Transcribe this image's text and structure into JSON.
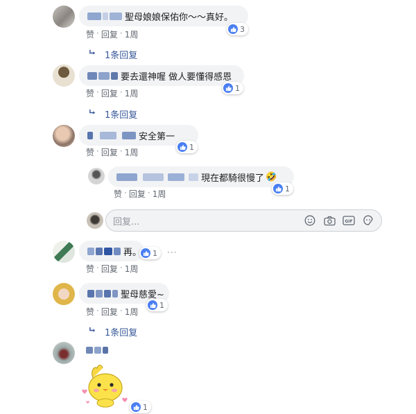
{
  "actions": {
    "like": "赞",
    "reply": "回复",
    "sep": "·",
    "time": "1周"
  },
  "comments": [
    {
      "text": "聖母娘娘保佑你～～真好。",
      "reactions": "3",
      "replies": "1条回复"
    },
    {
      "text": "要去還神喔 做人要懂得感恩",
      "reactions": "1",
      "replies": "1条回复"
    },
    {
      "text": "安全第一",
      "reactions": "1"
    },
    {
      "text": "再。",
      "reactions": "1"
    },
    {
      "text": "聖母慈愛~",
      "reactions": "1",
      "replies": "1条回复"
    },
    {
      "reactions": "1"
    }
  ],
  "nested_reply": {
    "text": "現在都騎很慢了",
    "emoji": "🤣",
    "reactions": "1",
    "time": "1周"
  },
  "reply_box": {
    "placeholder": "回复..."
  },
  "icons": [
    "emoji-icon",
    "camera-icon",
    "gif-icon",
    "sticker-icon",
    "like-icon",
    "reply-arrow-icon",
    "more-icon"
  ],
  "colors": {
    "link": "#385898",
    "bubble": "#f2f3f5",
    "like": "#4a7ff2",
    "meta": "#606770"
  }
}
